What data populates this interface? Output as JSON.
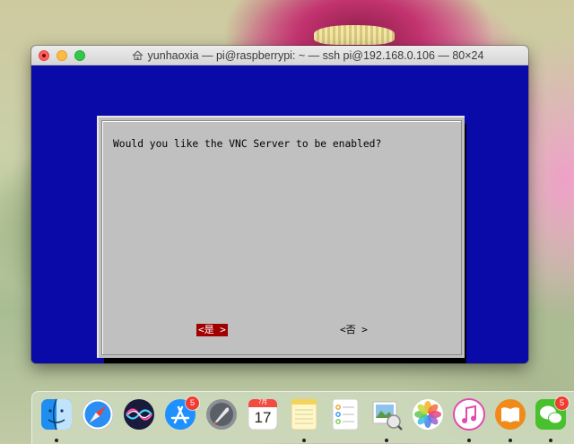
{
  "window": {
    "title": "yunhaoxia — pi@raspberrypi: ~ — ssh pi@192.168.0.106 — 80×24"
  },
  "dialog": {
    "prompt": "Would you like the VNC Server to be enabled?",
    "yes_label": "<是 >",
    "no_label": "<否 >"
  },
  "colors": {
    "terminal_background": "#0a0aa8",
    "dialog_background": "#c0c0c0",
    "selected_button": "#a00000"
  },
  "dock": {
    "items": [
      {
        "name": "Finder",
        "icon": "finder-icon",
        "running": true
      },
      {
        "name": "Safari",
        "icon": "safari-icon",
        "running": false
      },
      {
        "name": "Siri",
        "icon": "siri-icon",
        "running": false
      },
      {
        "name": "App Store",
        "icon": "app-store-icon",
        "running": false,
        "badge": "5"
      },
      {
        "name": "Launchpad",
        "icon": "launchpad-icon",
        "running": false
      },
      {
        "name": "Calendar",
        "icon": "calendar-icon",
        "running": false,
        "month": "7月",
        "day": "17"
      },
      {
        "name": "Notes",
        "icon": "notes-icon",
        "running": true
      },
      {
        "name": "Reminders",
        "icon": "reminders-icon",
        "running": false
      },
      {
        "name": "Preview",
        "icon": "preview-icon",
        "running": true
      },
      {
        "name": "Photos",
        "icon": "photos-icon",
        "running": false
      },
      {
        "name": "iTunes",
        "icon": "itunes-icon",
        "running": true
      },
      {
        "name": "iBooks",
        "icon": "ibooks-icon",
        "running": true
      },
      {
        "name": "WeChat",
        "icon": "wechat-icon",
        "running": true,
        "badge": "5"
      }
    ]
  }
}
